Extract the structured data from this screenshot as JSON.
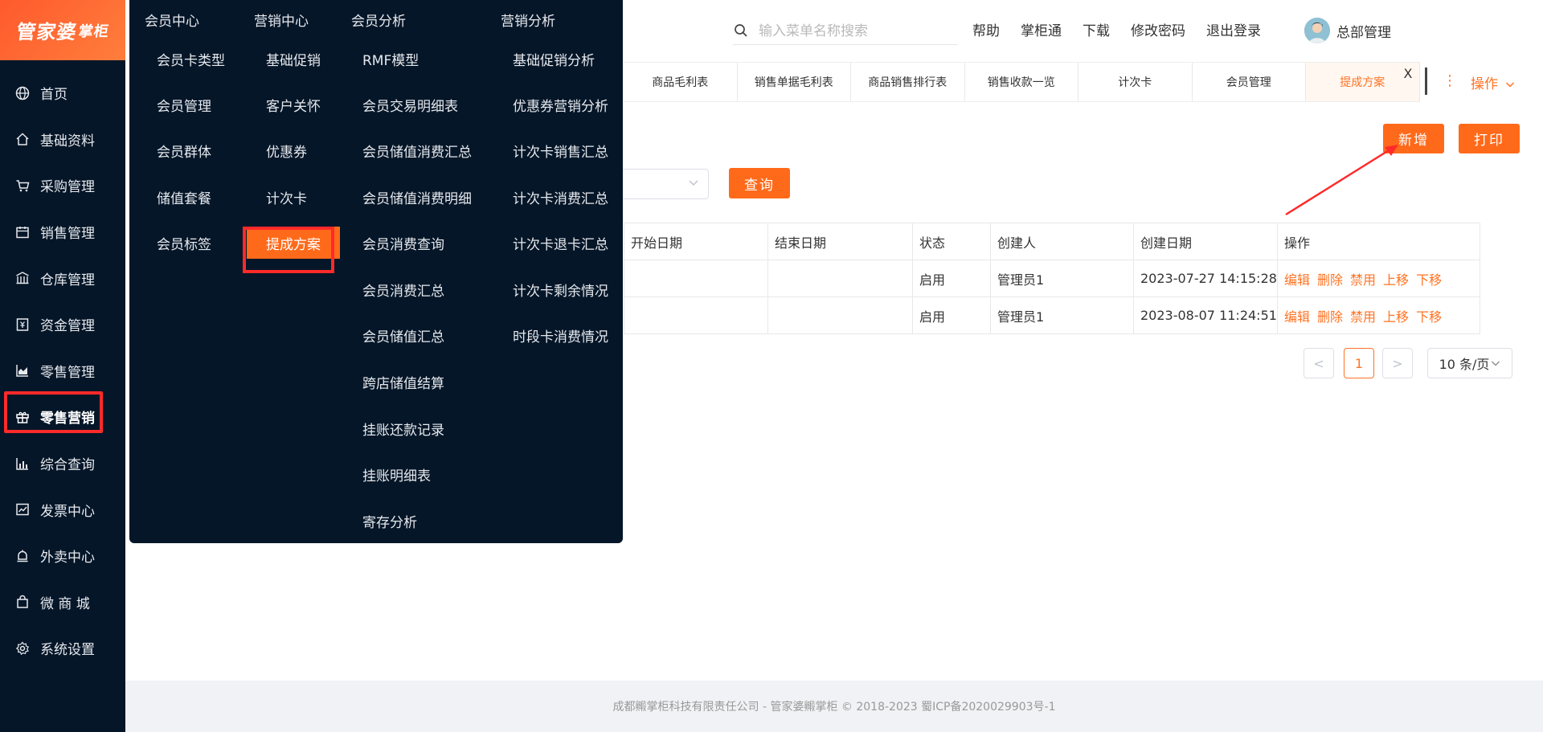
{
  "logo": {
    "text": "管家婆",
    "sub": "掌柜"
  },
  "sidebar": {
    "items": [
      {
        "label": "首页",
        "icon": "globe-icon"
      },
      {
        "label": "基础资料",
        "icon": "home-icon"
      },
      {
        "label": "采购管理",
        "icon": "cart-icon"
      },
      {
        "label": "销售管理",
        "icon": "calendar-icon"
      },
      {
        "label": "仓库管理",
        "icon": "warehouse-icon"
      },
      {
        "label": "资金管理",
        "icon": "money-icon"
      },
      {
        "label": "零售管理",
        "icon": "chart-icon"
      },
      {
        "label": "零售营销",
        "icon": "gift-icon",
        "active": true
      },
      {
        "label": "综合查询",
        "icon": "bar-chart-icon"
      },
      {
        "label": "发票中心",
        "icon": "line-chart-icon"
      },
      {
        "label": "外卖中心",
        "icon": "bell-icon"
      },
      {
        "label": "微 商 城",
        "icon": "bag-icon"
      },
      {
        "label": "系统设置",
        "icon": "gear-icon"
      }
    ]
  },
  "header": {
    "search_placeholder": "输入菜单名称搜索",
    "links": [
      "帮助",
      "掌柜通",
      "下载",
      "修改密码",
      "退出登录"
    ],
    "user": "总部管理"
  },
  "tabs": [
    {
      "label": "商品毛利表"
    },
    {
      "label": "销售单据毛利表"
    },
    {
      "label": "商品销售排行表"
    },
    {
      "label": "销售收款一览"
    },
    {
      "label": "计次卡"
    },
    {
      "label": "会员管理"
    },
    {
      "label": "提成方案",
      "active": true
    }
  ],
  "tab_close": "X",
  "tab_more": "⋮",
  "tab_ops": "操作",
  "buttons": {
    "add": "新增",
    "print": "打印",
    "query": "查询"
  },
  "table": {
    "headers": [
      "开始日期",
      "结束日期",
      "状态",
      "创建人",
      "创建日期",
      "操作"
    ],
    "rows": [
      {
        "start": "",
        "end": "",
        "status": "启用",
        "creator": "管理员1",
        "created": "2023-07-27 14:15:28"
      },
      {
        "start": "",
        "end": "",
        "status": "启用",
        "creator": "管理员1",
        "created": "2023-08-07 11:24:51"
      }
    ],
    "ops": [
      "编辑",
      "删除",
      "禁用",
      "上移",
      "下移"
    ]
  },
  "pager": {
    "prev": "<",
    "page": "1",
    "next": ">",
    "size": "10 条/页"
  },
  "footer": "成都毈掌柜科技有限责任公司 - 管家婆毈掌柜 © 2018-2023 蜀ICP备2020029903号-1",
  "mega": {
    "columns": [
      {
        "head": "会员中心",
        "items": [
          "会员卡类型",
          "会员管理",
          "会员群体",
          "储值套餐",
          "会员标签"
        ]
      },
      {
        "head": "营销中心",
        "items": [
          "基础促销",
          "客户关怀",
          "优惠券",
          "计次卡",
          "提成方案"
        ]
      },
      {
        "head": "会员分析",
        "items": [
          "RMF模型",
          "会员交易明细表",
          "会员储值消费汇总",
          "会员储值消费明细",
          "会员消费查询",
          "会员消费汇总",
          "会员储值汇总",
          "跨店储值结算",
          "挂账还款记录",
          "挂账明细表",
          "寄存分析"
        ]
      },
      {
        "head": "营销分析",
        "items": [
          "基础促销分析",
          "优惠券营销分析",
          "计次卡销售汇总",
          "计次卡消费汇总",
          "计次卡退卡汇总",
          "计次卡剩余情况",
          "时段卡消费情况"
        ]
      }
    ]
  },
  "colors": {
    "accent": "#ff6a1a",
    "sidebar": "#051628",
    "highlight_box": "#ff2a2a"
  }
}
